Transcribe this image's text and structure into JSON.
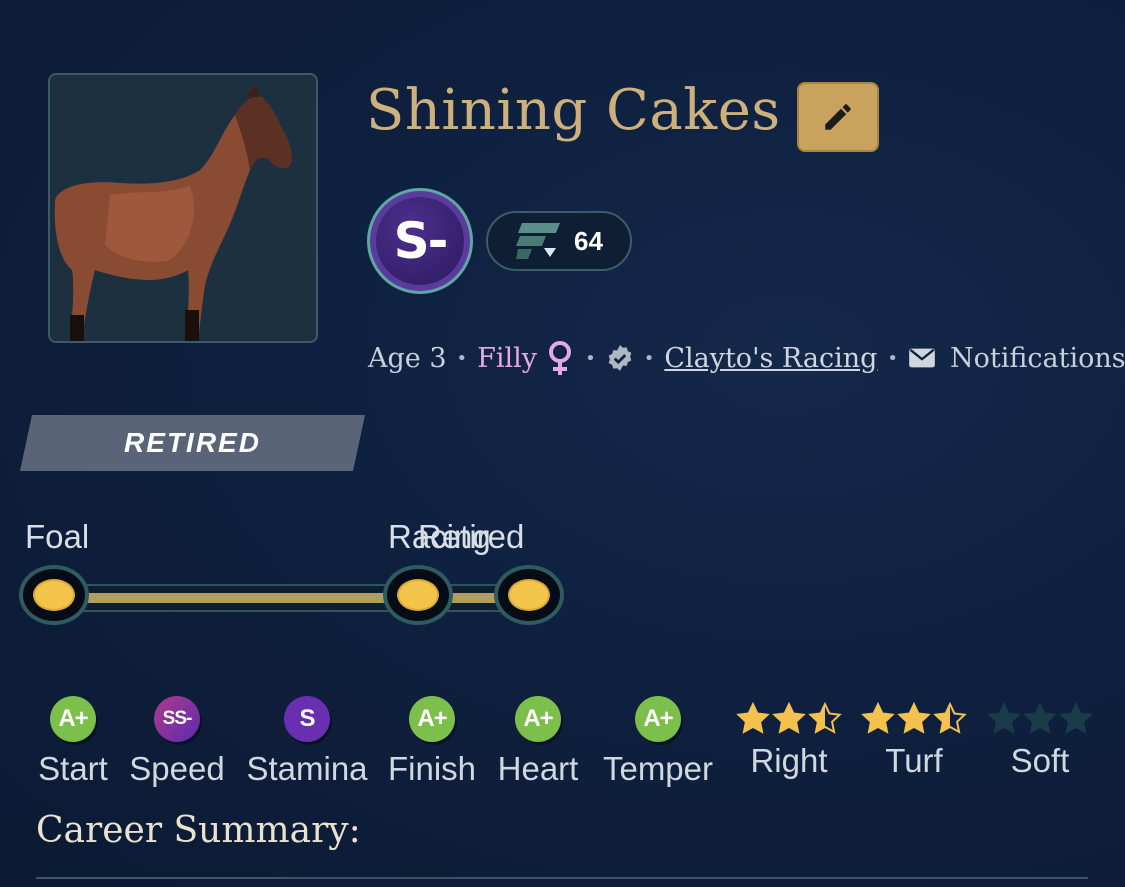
{
  "horse": {
    "name": "Shining Cakes",
    "grade": "S-",
    "rating": "64",
    "age": "Age 3",
    "sex": "Filly",
    "owner": "Clayto's Racing",
    "notifications_label": "Notifications",
    "status": "RETIRED"
  },
  "icons": {
    "edit": "pencil-icon",
    "sex": "female-icon",
    "verified": "verified-badge-icon",
    "mail": "mail-icon",
    "rating": "rating-logo-icon"
  },
  "timeline": {
    "stages": [
      "Foal",
      "Racing",
      "Retired"
    ],
    "progress": 1.0
  },
  "stats": [
    {
      "grade": "A+",
      "label": "Start",
      "color": "#7cc04b"
    },
    {
      "grade": "SS-",
      "label": "Speed",
      "color": "#8a3aa0"
    },
    {
      "grade": "S",
      "label": "Stamina",
      "color": "#6a2fb0"
    },
    {
      "grade": "A+",
      "label": "Finish",
      "color": "#7cc04b"
    },
    {
      "grade": "A+",
      "label": "Heart",
      "color": "#7cc04b"
    },
    {
      "grade": "A+",
      "label": "Temper",
      "color": "#7cc04b"
    }
  ],
  "preferences": [
    {
      "label": "Right",
      "stars": 2.5
    },
    {
      "label": "Turf",
      "stars": 2.5
    },
    {
      "label": "Soft",
      "stars": 0
    }
  ],
  "colors": {
    "background": "#0f2140",
    "accent_gold": "#c9a25e",
    "name_gold": "#cdb07c",
    "star_gold": "#f2c14e",
    "star_empty": "#1b3a4a"
  },
  "career_summary_title": "Career Summary:"
}
